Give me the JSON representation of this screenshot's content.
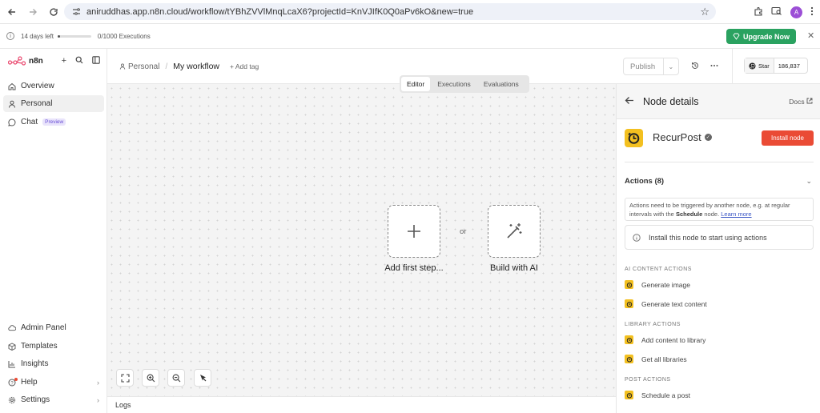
{
  "browser": {
    "url": "aniruddhas.app.n8n.cloud/workflow/tYBhZVVlMnqLcaX6?projectId=KnVJIfK0Q0aPv6kO&new=true",
    "profile_initial": "A"
  },
  "trial": {
    "days_left": "14 days left",
    "days_used_fraction": 0.08,
    "executions": "0/1000 Executions",
    "upgrade_label": "Upgrade Now"
  },
  "sidebar": {
    "logo_text": "n8n",
    "items": [
      {
        "label": "Overview",
        "icon": "house-icon"
      },
      {
        "label": "Personal",
        "icon": "user-icon"
      },
      {
        "label": "Chat",
        "icon": "chat-icon",
        "badge": "Preview"
      }
    ],
    "bottom_items": [
      {
        "label": "Admin Panel",
        "icon": "cloud-icon"
      },
      {
        "label": "Templates",
        "icon": "package-icon"
      },
      {
        "label": "Insights",
        "icon": "chart-icon"
      },
      {
        "label": "Help",
        "icon": "help-icon"
      },
      {
        "label": "Settings",
        "icon": "gear-icon"
      }
    ]
  },
  "header": {
    "project": "Personal",
    "workflow_name": "My workflow",
    "add_tag": "+ Add tag",
    "publish_label": "Publish",
    "github_star_label": "Star",
    "github_stars": "186,837"
  },
  "canvas": {
    "tabs": [
      "Editor",
      "Executions",
      "Evaluations"
    ],
    "active_tab": "Editor",
    "add_first_step": "Add first step...",
    "or_text": "or",
    "build_with_ai": "Build with AI",
    "logs_label": "Logs"
  },
  "panel": {
    "title": "Node details",
    "docs_label": "Docs",
    "node_name": "RecurPost",
    "install_label": "Install node",
    "actions_heading": "Actions (8)",
    "note_text_1": "Actions need to be triggered by another node, e.g. at regular intervals with the ",
    "note_bold": "Schedule",
    "note_text_2": " node. ",
    "note_link": "Learn more",
    "install_note": "Install this node to start using actions",
    "sections": [
      {
        "heading": "AI CONTENT ACTIONS",
        "actions": [
          "Generate image",
          "Generate text content"
        ]
      },
      {
        "heading": "LIBRARY ACTIONS",
        "actions": [
          "Add content to library",
          "Get all libraries"
        ]
      },
      {
        "heading": "POST ACTIONS",
        "actions": [
          "Schedule a post"
        ]
      }
    ]
  },
  "colors": {
    "upgrade_green": "#2aa260",
    "install_red": "#ea4b35",
    "recurpost_yellow": "#f3c020",
    "link_blue": "#3955c5"
  }
}
